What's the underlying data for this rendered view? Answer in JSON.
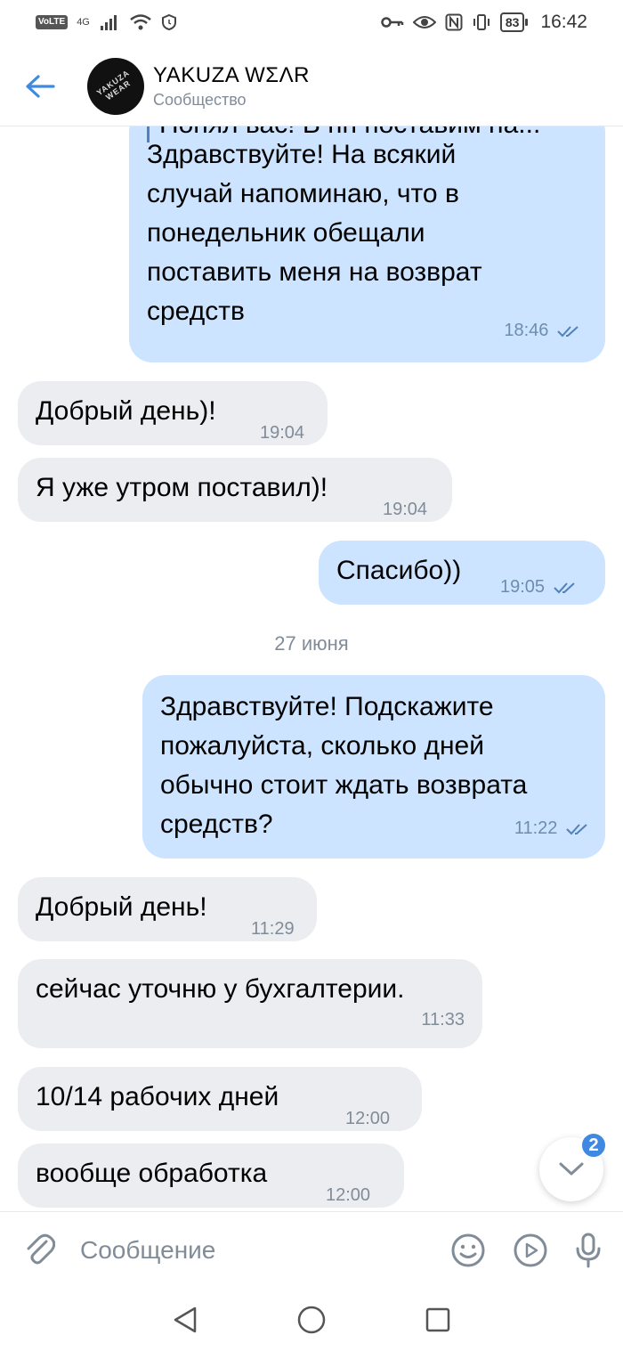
{
  "status_bar": {
    "network": "VoLTE",
    "signal_type": "4G",
    "battery": "83",
    "time": "16:42"
  },
  "header": {
    "title": "YAKUZA WΣΛR",
    "subtitle": "Сообщество",
    "avatar_text": "YAKUZA WEAR"
  },
  "messages": [
    {
      "direction": "out",
      "reply_preview": "Понял вас! В пн поставим на...",
      "lines": [
        "Здравствуйте! На всякий",
        "случай напоминаю, что в",
        "понедельник обещали",
        "поставить меня на возврат",
        "средств"
      ],
      "time": "18:46",
      "read": true
    },
    {
      "direction": "in",
      "text": "Добрый день)!",
      "time": "19:04"
    },
    {
      "direction": "in",
      "text": "Я уже утром поставил)!",
      "time": "19:04"
    },
    {
      "direction": "out",
      "text": "Спасибо))",
      "time": "19:05",
      "read": true
    },
    {
      "date": "27 июня"
    },
    {
      "direction": "out",
      "lines": [
        "Здравствуйте! Подскажите",
        "пожалуйста, сколько дней",
        "обычно стоит ждать возврата",
        "средств?"
      ],
      "time": "11:22",
      "read": true
    },
    {
      "direction": "in",
      "text": "Добрый день!",
      "time": "11:29"
    },
    {
      "direction": "in",
      "text": "сейчас уточню у бухгалтерии.",
      "time": "11:33"
    },
    {
      "direction": "in",
      "text": "10/14 рабочих дней",
      "time": "12:00"
    },
    {
      "direction": "in",
      "text": "вообще обработка",
      "time": "12:00"
    }
  ],
  "scroll_down": {
    "badge": "2"
  },
  "input": {
    "placeholder": "Сообщение"
  },
  "colors": {
    "accent": "#3f8ae0",
    "outgoing_bubble": "#cce4ff",
    "incoming_bubble": "#ebedf0",
    "muted": "#818c99"
  }
}
